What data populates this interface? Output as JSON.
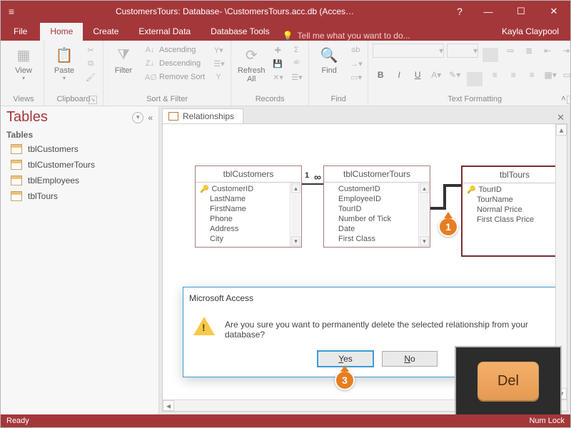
{
  "colors": {
    "accent": "#a4373a",
    "callout": "#e67e22"
  },
  "titlebar": {
    "title": "CustomersTours: Database- \\CustomersTours.acc.db (Acces…",
    "help": "?",
    "min": "—",
    "max": "☐",
    "close": "✕"
  },
  "tabs": {
    "file": "File",
    "home": "Home",
    "create": "Create",
    "external": "External Data",
    "dbtools": "Database Tools",
    "tellme": "Tell me what you want to do...",
    "user": "Kayla Claypool"
  },
  "ribbon": {
    "views": {
      "label": "Views",
      "view": "View"
    },
    "clipboard": {
      "label": "Clipboard",
      "paste": "Paste"
    },
    "sortfilter": {
      "label": "Sort & Filter",
      "filter": "Filter",
      "asc": "Ascending",
      "desc": "Descending",
      "remove": "Remove Sort"
    },
    "records": {
      "label": "Records",
      "refresh": "Refresh\nAll"
    },
    "find": {
      "label": "Find",
      "find": "Find"
    },
    "textfmt": {
      "label": "Text Formatting"
    }
  },
  "nav": {
    "title": "Tables",
    "subhead": "Tables",
    "items": [
      "tblCustomers",
      "tblCustomerTours",
      "tblEmployees",
      "tblTours"
    ]
  },
  "doc": {
    "tab": "Relationships"
  },
  "rel": {
    "boxes": [
      {
        "title": "tblCustomers",
        "fields": [
          {
            "k": true,
            "n": "CustomerID"
          },
          {
            "k": false,
            "n": "LastName"
          },
          {
            "k": false,
            "n": "FirstName"
          },
          {
            "k": false,
            "n": "Phone"
          },
          {
            "k": false,
            "n": "Address"
          },
          {
            "k": false,
            "n": "City"
          }
        ]
      },
      {
        "title": "tblCustomerTours",
        "fields": [
          {
            "k": false,
            "n": "CustomerID"
          },
          {
            "k": false,
            "n": "EmployeeID"
          },
          {
            "k": false,
            "n": "TourID"
          },
          {
            "k": false,
            "n": "Number of Tick"
          },
          {
            "k": false,
            "n": "Date"
          },
          {
            "k": false,
            "n": "First Class"
          }
        ]
      },
      {
        "title": "tblTours",
        "fields": [
          {
            "k": true,
            "n": "TourID"
          },
          {
            "k": false,
            "n": "TourName"
          },
          {
            "k": false,
            "n": "Normal Price"
          },
          {
            "k": false,
            "n": "First Class Price"
          }
        ]
      }
    ],
    "card1": "1",
    "cardInf": "∞"
  },
  "dialog": {
    "title": "Microsoft Access",
    "msg": "Are you sure you want to permanently delete the selected relationship from your database?",
    "yes_pre": "",
    "yes_ul": "Y",
    "yes_post": "es",
    "no_pre": "",
    "no_ul": "N",
    "no_post": "o"
  },
  "callouts": {
    "c1": "1",
    "c3": "3"
  },
  "delkey": "Del",
  "status": {
    "left": "Ready",
    "right": "Num Lock"
  }
}
